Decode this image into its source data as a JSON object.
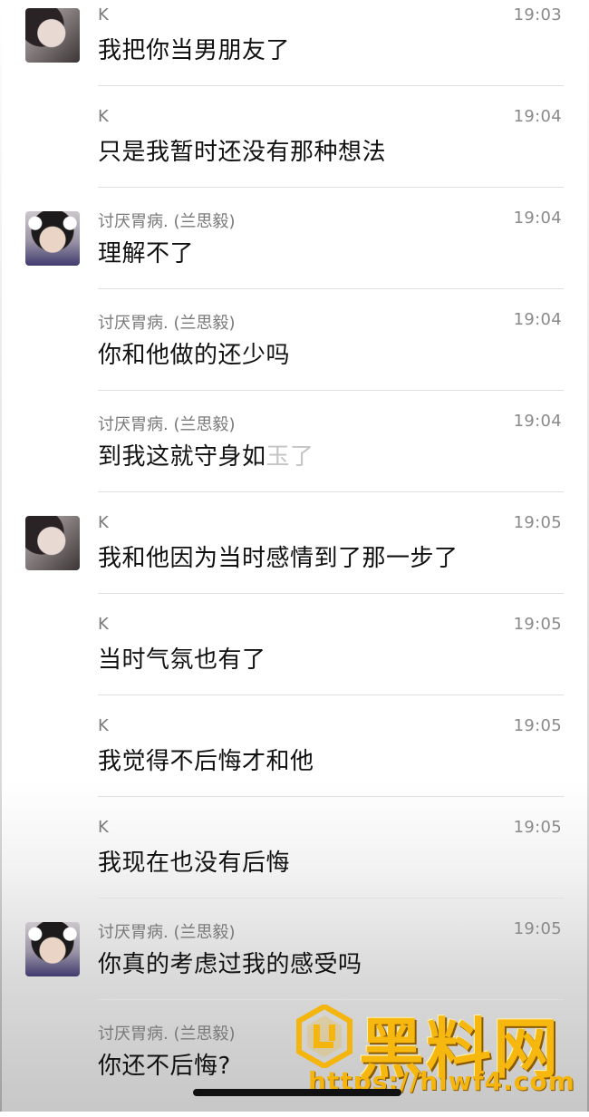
{
  "messages": [
    {
      "sender": "K",
      "time": "19:03",
      "text": "我把你当男朋友了",
      "avatar": "k"
    },
    {
      "sender": "K",
      "time": "19:04",
      "text": "只是我暂时还没有那种想法",
      "avatar": ""
    },
    {
      "sender": "讨厌胃病. (兰思毅)",
      "time": "19:04",
      "text": "理解不了",
      "avatar": "l"
    },
    {
      "sender": "讨厌胃病. (兰思毅)",
      "time": "19:04",
      "text": "你和他做的还少吗",
      "avatar": ""
    },
    {
      "sender": "讨厌胃病. (兰思毅)",
      "time": "19:04",
      "text": "到我这就守身如",
      "text_faded": "玉了",
      "avatar": ""
    },
    {
      "sender": "K",
      "time": "19:05",
      "text": "我和他因为当时感情到了那一步了",
      "avatar": "k"
    },
    {
      "sender": "K",
      "time": "19:05",
      "text": "当时气氛也有了",
      "avatar": ""
    },
    {
      "sender": "K",
      "time": "19:05",
      "text": "我觉得不后悔才和他",
      "avatar": ""
    },
    {
      "sender": "K",
      "time": "19:05",
      "text": "我现在也没有后悔",
      "avatar": ""
    },
    {
      "sender": "讨厌胃病. (兰思毅)",
      "time": "19:05",
      "text": "你真的考虑过我的感受吗",
      "avatar": "l"
    },
    {
      "sender": "讨厌胃病. (兰思毅)",
      "time": "",
      "text": "你还不后悔?",
      "avatar": ""
    }
  ],
  "watermark": {
    "title": "黑料网",
    "url": "https://hlwf4.com"
  }
}
